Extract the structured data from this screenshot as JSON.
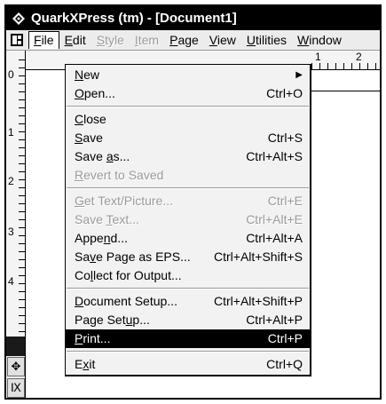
{
  "window": {
    "title": "QuarkXPress (tm) - [Document1]",
    "app_icon": "quark-diamond-icon"
  },
  "menubar": {
    "doc_icon": "document-control-icon",
    "items": [
      {
        "label": "File",
        "accel": "F",
        "rest": "ile",
        "state": "open"
      },
      {
        "label": "Edit",
        "accel": "E",
        "rest": "dit",
        "state": "normal"
      },
      {
        "label": "Style",
        "accel": "S",
        "rest": "tyle",
        "state": "disabled"
      },
      {
        "label": "Item",
        "accel": "I",
        "rest": "tem",
        "state": "disabled"
      },
      {
        "label": "Page",
        "accel": "P",
        "rest": "age",
        "state": "normal"
      },
      {
        "label": "View",
        "accel": "V",
        "rest": "iew",
        "state": "normal"
      },
      {
        "label": "Utilities",
        "accel": "U",
        "rest": "tilities",
        "state": "normal"
      },
      {
        "label": "Window",
        "accel": "W",
        "rest": "indow",
        "state": "normal"
      }
    ]
  },
  "rulers": {
    "vertical_labels": [
      "0",
      "1",
      "2",
      "3",
      "4"
    ],
    "horizontal_labels": [
      "1",
      "2"
    ]
  },
  "file_menu": {
    "groups": [
      [
        {
          "pre": "",
          "accel": "N",
          "post": "ew",
          "shortcut": "",
          "submenu": true,
          "state": "normal"
        },
        {
          "pre": "",
          "accel": "O",
          "post": "pen...",
          "shortcut": "Ctrl+O",
          "state": "normal"
        }
      ],
      [
        {
          "pre": "",
          "accel": "C",
          "post": "lose",
          "shortcut": "",
          "state": "normal"
        },
        {
          "pre": "",
          "accel": "S",
          "post": "ave",
          "shortcut": "Ctrl+S",
          "state": "normal"
        },
        {
          "pre": "Save ",
          "accel": "a",
          "post": "s...",
          "shortcut": "Ctrl+Alt+S",
          "state": "normal"
        },
        {
          "pre": "",
          "accel": "R",
          "post": "evert to Saved",
          "shortcut": "",
          "state": "disabled"
        }
      ],
      [
        {
          "pre": "",
          "accel": "G",
          "post": "et Text/Picture...",
          "shortcut": "Ctrl+E",
          "state": "disabled"
        },
        {
          "pre": "Save ",
          "accel": "T",
          "post": "ext...",
          "shortcut": "Ctrl+Alt+E",
          "state": "disabled"
        },
        {
          "pre": "Appe",
          "accel": "n",
          "post": "d...",
          "shortcut": "Ctrl+Alt+A",
          "state": "normal"
        },
        {
          "pre": "Sa",
          "accel": "v",
          "post": "e Page as EPS...",
          "shortcut": "Ctrl+Alt+Shift+S",
          "state": "normal"
        },
        {
          "pre": "Co",
          "accel": "l",
          "post": "lect for Output...",
          "shortcut": "",
          "state": "normal"
        }
      ],
      [
        {
          "pre": "",
          "accel": "D",
          "post": "ocument Setup...",
          "shortcut": "Ctrl+Alt+Shift+P",
          "state": "normal"
        },
        {
          "pre": "Page Set",
          "accel": "u",
          "post": "p...",
          "shortcut": "Ctrl+Alt+P",
          "state": "normal"
        },
        {
          "pre": "",
          "accel": "P",
          "post": "rint...",
          "shortcut": "Ctrl+P",
          "state": "selected"
        }
      ],
      [
        {
          "pre": "E",
          "accel": "x",
          "post": "it",
          "shortcut": "Ctrl+Q",
          "state": "normal"
        }
      ]
    ]
  },
  "colors": {
    "title_bg": "#000000",
    "selection_bg": "#000000",
    "disabled_text": "#9a9a9a"
  }
}
